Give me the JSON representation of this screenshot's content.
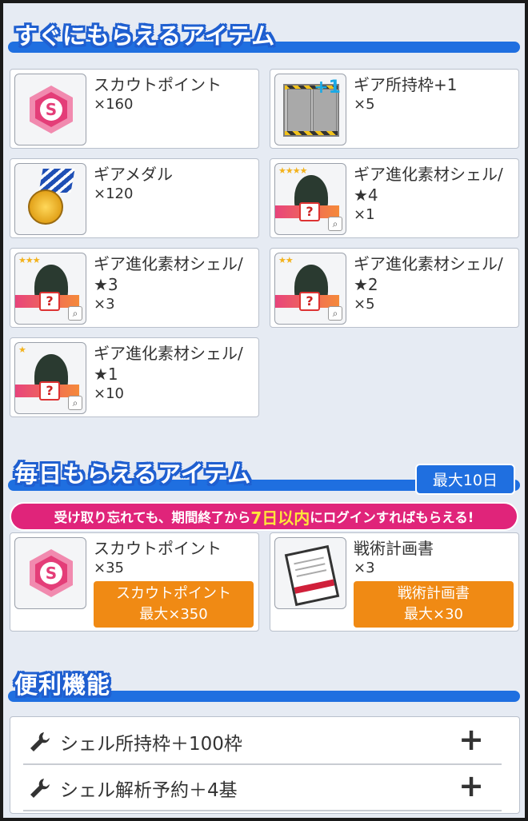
{
  "section_instant": {
    "title": "すぐにもらえるアイテム"
  },
  "instant_items": [
    {
      "name": "スカウトポイント",
      "qty": "×160",
      "icon": "scout-point-icon"
    },
    {
      "name": "ギア所持枠+1",
      "qty": "×5",
      "icon": "gear-slot-icon"
    },
    {
      "name": "ギアメダル",
      "qty": "×120",
      "icon": "gear-medal-icon"
    },
    {
      "name": "ギア進化素材シェル/",
      "name2": "★4",
      "qty": "×1",
      "icon": "shell-icon",
      "stars": "★★★★"
    },
    {
      "name": "ギア進化素材シェル/",
      "name2": "★3",
      "qty": "×3",
      "icon": "shell-icon",
      "stars": "★★★"
    },
    {
      "name": "ギア進化素材シェル/",
      "name2": "★2",
      "qty": "×5",
      "icon": "shell-icon",
      "stars": "★★"
    },
    {
      "name": "ギア進化素材シェル/",
      "name2": "★1",
      "qty": "×10",
      "icon": "shell-icon",
      "stars": "★"
    }
  ],
  "section_daily": {
    "title": "毎日もらえるアイテム",
    "badge": "最大10日"
  },
  "notice": {
    "pre": "受け取り忘れても、期間終了から",
    "highlight": "7日以内",
    "post": "にログインすればもらえる!"
  },
  "daily_items": [
    {
      "name": "スカウトポイント",
      "qty": "×35",
      "btn_line1": "スカウトポイント",
      "btn_line2": "最大×350",
      "icon": "scout-point-icon"
    },
    {
      "name": "戦術計画書",
      "qty": "×3",
      "btn_line1": "戦術計画書",
      "btn_line2": "最大×30",
      "icon": "tactics-book-icon"
    }
  ],
  "section_convenience": {
    "title": "便利機能"
  },
  "convenience": [
    {
      "label": "シェル所持枠＋100枠",
      "icon": "wrench-icon",
      "action": "+"
    },
    {
      "label": "シェル解析予約＋4基",
      "icon": "wrench-icon",
      "action": "+"
    }
  ],
  "colors": {
    "accent_blue": "#1f6fe0",
    "orange": "#f08a14",
    "pink": "#e0247a",
    "bg": "#e6ebf3"
  }
}
